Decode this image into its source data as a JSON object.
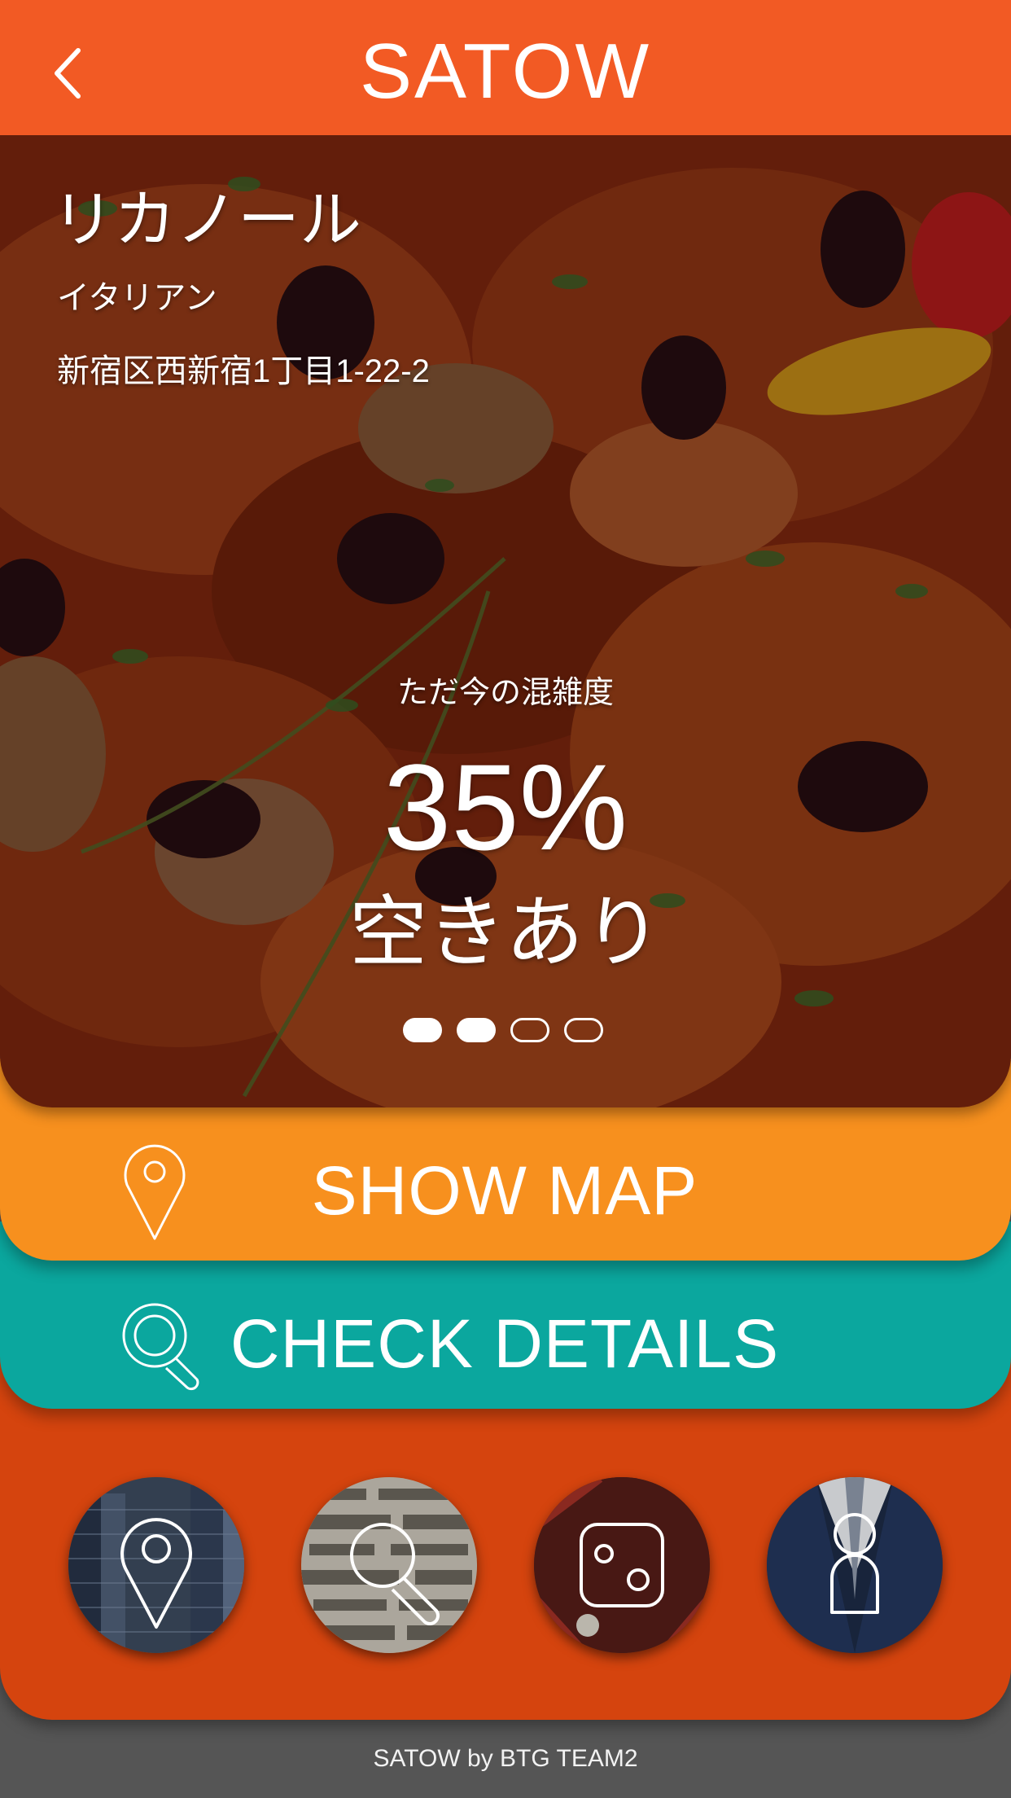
{
  "header": {
    "title": "SATOW",
    "back_icon": "chevron-left-icon",
    "background_color": "#F25A24"
  },
  "restaurant": {
    "name": "リカノール",
    "genre": "イタリアン",
    "address": "新宿区西新宿1丁目1-22-2"
  },
  "crowd": {
    "caption": "ただ今の混雑度",
    "value": "35%",
    "status": "空きあり"
  },
  "pager": {
    "total": 4,
    "filled": 2
  },
  "actions": {
    "show_map": {
      "label": "SHOW MAP",
      "icon": "map-pin-icon",
      "color": "#F7901E"
    },
    "check_details": {
      "label": "CHECK DETAILS",
      "icon": "search-icon",
      "color": "#0BA79E"
    }
  },
  "bottom_nav": {
    "color": "#D5440E",
    "items": [
      {
        "icon": "map-pin-icon"
      },
      {
        "icon": "search-icon"
      },
      {
        "icon": "instagram-icon"
      },
      {
        "icon": "user-icon"
      }
    ]
  },
  "footer": {
    "text": "SATOW by BTG TEAM2"
  }
}
